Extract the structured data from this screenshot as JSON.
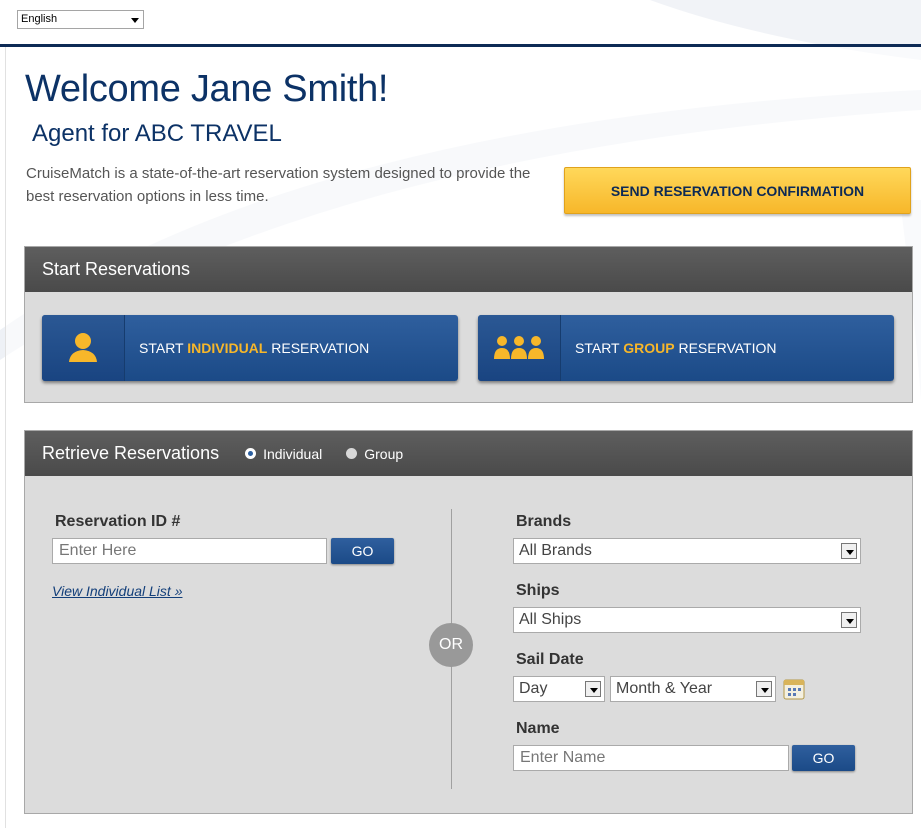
{
  "language": {
    "selected": "English"
  },
  "header": {
    "welcome": "Welcome Jane Smith!",
    "agent": "Agent for ABC TRAVEL",
    "description": "CruiseMatch is a state-of-the-art reservation system designed to provide the best reservation options in less time.",
    "send_confirmation_label": "SEND RESERVATION CONFIRMATION"
  },
  "start_reservations": {
    "title": "Start Reservations",
    "individual": {
      "prefix": "START ",
      "highlight": "INDIVIDUAL",
      "suffix": " RESERVATION"
    },
    "group": {
      "prefix": "START ",
      "highlight": "GROUP",
      "suffix": " RESERVATION"
    }
  },
  "retrieve_reservations": {
    "title": "Retrieve Reservations",
    "radio_options": [
      {
        "label": "Individual",
        "checked": true
      },
      {
        "label": "Group",
        "checked": false
      }
    ],
    "reservation_id": {
      "label": "Reservation ID #",
      "placeholder": "Enter Here",
      "go_label": "GO"
    },
    "view_list_link": "View Individual List »",
    "or_label": "OR",
    "brands": {
      "label": "Brands",
      "selected": "All Brands"
    },
    "ships": {
      "label": "Ships",
      "selected": "All Ships"
    },
    "sail_date": {
      "label": "Sail Date",
      "day": "Day",
      "month_year": "Month & Year"
    },
    "name": {
      "label": "Name",
      "placeholder": "Enter Name",
      "go_label": "GO"
    }
  },
  "colors": {
    "brand_navy": "#0c3266",
    "accent_gold": "#f7b72a",
    "button_blue": "#1b4a87",
    "panel_header": "#4a4a4a"
  }
}
